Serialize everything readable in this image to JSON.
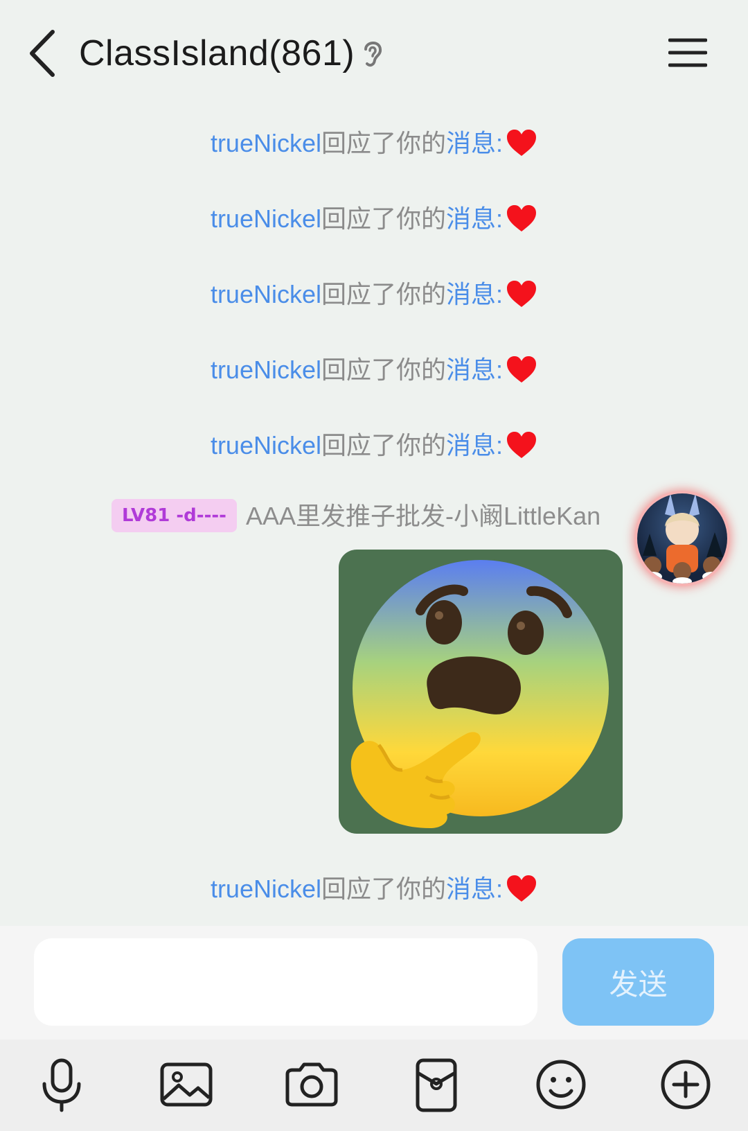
{
  "header": {
    "title": "ClassIsland(861)",
    "back_icon": "chevron-left-icon",
    "ear_icon": "ear-icon",
    "menu_icon": "hamburger-menu-icon"
  },
  "notice": {
    "user": "trueNickel",
    "text": "回应了你的",
    "link": "消息",
    "colon": ":",
    "reaction_icon": "red-heart-icon"
  },
  "sender": {
    "level_badge": "LV81 -d----",
    "name": "AAA里发推子批发-小阚LittleKan",
    "avatar": "avatar-image",
    "sticker": "thinking-fearful-face-sticker"
  },
  "composer": {
    "input_value": "",
    "send_label": "发送"
  },
  "toolbar": {
    "items": [
      "microphone-icon",
      "image-icon",
      "camera-icon",
      "red-packet-icon",
      "emoji-icon",
      "plus-circle-icon"
    ]
  },
  "colors": {
    "background": "#eef2ef",
    "link_blue": "#4a8de8",
    "send_button": "#7ec3f5",
    "badge_bg": "#f4cdf1",
    "badge_text": "#b03ad8"
  }
}
